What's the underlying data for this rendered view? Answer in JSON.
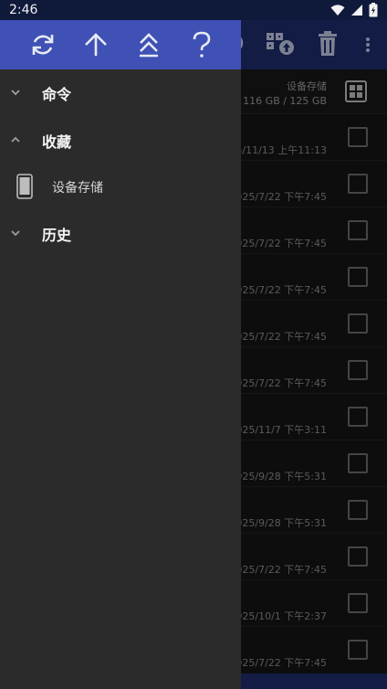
{
  "status_bar": {
    "time": "2:46"
  },
  "drawer": {
    "toolbar_icons": [
      "refresh-icon",
      "arrow-up-icon",
      "chevrons-up-icon",
      "help-icon"
    ],
    "sections": [
      {
        "label": "命令",
        "expanded": false
      },
      {
        "label": "收藏",
        "expanded": true,
        "items": [
          {
            "label": "设备存储",
            "icon": "phone-icon"
          }
        ]
      },
      {
        "label": "历史",
        "expanded": false
      }
    ]
  },
  "file_list": {
    "storage_title": "设备存储",
    "storage_size": "116 GB / 125 GB",
    "rows": [
      {
        "date": "25/11/13 上午11:13"
      },
      {
        "date": "2025/7/22 下午7:45"
      },
      {
        "date": "2025/7/22 下午7:45"
      },
      {
        "date": "2025/7/22 下午7:45"
      },
      {
        "date": "2025/7/22 下午7:45"
      },
      {
        "date": "2025/7/22 下午7:45"
      },
      {
        "date": "2025/11/7 下午3:11"
      },
      {
        "date": "2025/9/28 下午5:31"
      },
      {
        "date": "2025/9/28 下午5:31"
      },
      {
        "date": "2025/7/22 下午7:45"
      },
      {
        "date": "2025/10/1 下午2:37"
      },
      {
        "date": "2025/7/22 下午7:45"
      }
    ]
  },
  "colors": {
    "drawer_header": "#3f51b5",
    "drawer_bg": "#2b2b2b",
    "toolbar": "#1c2b6b"
  }
}
